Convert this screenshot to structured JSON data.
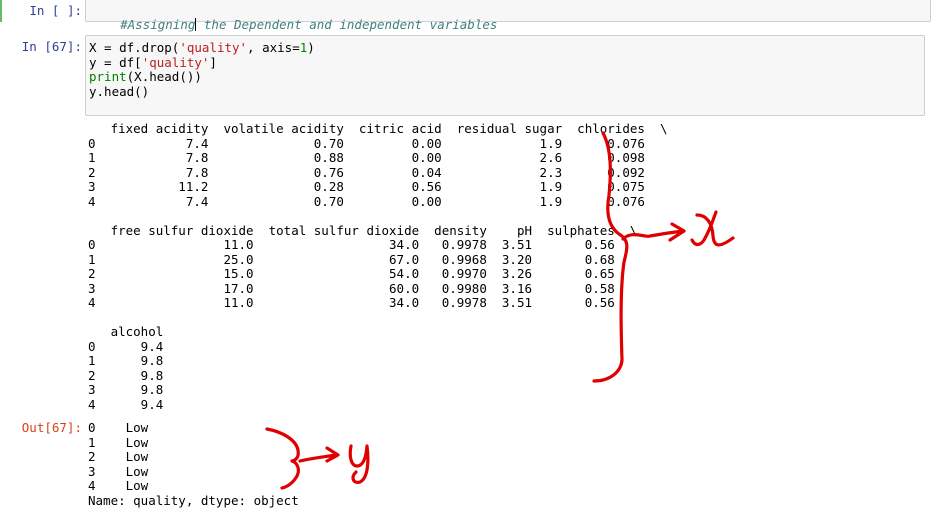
{
  "cells": {
    "comment_cell": {
      "prompt": "In [ ]:",
      "code_before_cursor": "#Assigning",
      "code_after_cursor": " the Dependent and independent variables"
    },
    "code_cell": {
      "prompt": "In [67]:",
      "line1": {
        "a": "X = df.drop(",
        "s": "'quality'",
        "b": ", axis=",
        "n": "1",
        "c": ")"
      },
      "line2": {
        "a": "y = df[",
        "s": "'quality'",
        "b": "]"
      },
      "line3": {
        "kw": "print",
        "rest": "(X.head())"
      },
      "line4": "y.head()"
    },
    "stdout": "   fixed acidity  volatile acidity  citric acid  residual sugar  chlorides  \\\n0            7.4              0.70         0.00             1.9      0.076   \n1            7.8              0.88         0.00             2.6      0.098   \n2            7.8              0.76         0.04             2.3      0.092   \n3           11.2              0.28         0.56             1.9      0.075   \n4            7.4              0.70         0.00             1.9      0.076   \n\n   free sulfur dioxide  total sulfur dioxide  density    pH  sulphates  \\\n0                 11.0                  34.0   0.9978  3.51       0.56   \n1                 25.0                  67.0   0.9968  3.20       0.68   \n2                 15.0                  54.0   0.9970  3.26       0.65   \n3                 17.0                  60.0   0.9980  3.16       0.58   \n4                 11.0                  34.0   0.9978  3.51       0.56   \n\n   alcohol  \n0      9.4  \n1      9.8  \n2      9.8  \n3      9.8  \n4      9.4  ",
    "out_prompt": "Out[67]:",
    "out_value": "0    Low\n1    Low\n2    Low\n3    Low\n4    Low\nName: quality, dtype: object"
  },
  "annotations": {
    "x_label": "X",
    "y_label": "y",
    "ink_color": "#e00000"
  }
}
